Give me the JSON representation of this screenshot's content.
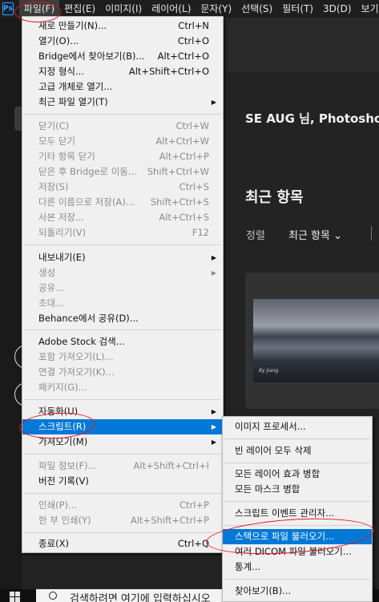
{
  "menubar": {
    "logo": "Ps",
    "items": [
      "파일(F)",
      "편집(E)",
      "이미지(I)",
      "레이어(L)",
      "문자(Y)",
      "선택(S)",
      "필터(T)",
      "3D(D)",
      "보기(V)"
    ]
  },
  "home": {
    "welcome": "SE AUG 님, Photoshop",
    "recent_title": "최근 항목",
    "sort_label": "정렬",
    "sort_value": "최근 항목 ⌄",
    "thumb_caption": "By Jiang"
  },
  "file_menu": {
    "items": [
      {
        "label": "새로 만들기(N)...",
        "shortcut": "Ctrl+N"
      },
      {
        "label": "열기(O)...",
        "shortcut": "Ctrl+O"
      },
      {
        "label": "Bridge에서 찾아보기(B)...",
        "shortcut": "Alt+Ctrl+O"
      },
      {
        "label": "지정 형식...",
        "shortcut": "Alt+Shift+Ctrl+O"
      },
      {
        "label": "고급 개체로 열기...",
        "shortcut": ""
      },
      {
        "label": "최근 파일 열기(T)",
        "shortcut": ""
      },
      {
        "label": "닫기(C)",
        "shortcut": "Ctrl+W"
      },
      {
        "label": "모두 닫기",
        "shortcut": "Alt+Ctrl+W"
      },
      {
        "label": "기타 항목 닫기",
        "shortcut": "Alt+Ctrl+P"
      },
      {
        "label": "닫은 후 Bridge로 이동...",
        "shortcut": "Shift+Ctrl+W"
      },
      {
        "label": "저장(S)",
        "shortcut": "Ctrl+S"
      },
      {
        "label": "다른 이름으로 저장(A)...",
        "shortcut": "Shift+Ctrl+S"
      },
      {
        "label": "사본 저장...",
        "shortcut": "Alt+Ctrl+S"
      },
      {
        "label": "되돌리기(V)",
        "shortcut": "F12"
      },
      {
        "label": "내보내기(E)",
        "shortcut": ""
      },
      {
        "label": "생성",
        "shortcut": ""
      },
      {
        "label": "공유...",
        "shortcut": ""
      },
      {
        "label": "초대...",
        "shortcut": ""
      },
      {
        "label": "Behance에서 공유(D)...",
        "shortcut": ""
      },
      {
        "label": "Adobe Stock 검색...",
        "shortcut": ""
      },
      {
        "label": "포함 가져오기(L)...",
        "shortcut": ""
      },
      {
        "label": "연결 가져오기(K)...",
        "shortcut": ""
      },
      {
        "label": "패키지(G)...",
        "shortcut": ""
      },
      {
        "label": "자동화(U)",
        "shortcut": ""
      },
      {
        "label": "스크립트(R)",
        "shortcut": ""
      },
      {
        "label": "가져오기(M)",
        "shortcut": ""
      },
      {
        "label": "파일 정보(F)...",
        "shortcut": "Alt+Shift+Ctrl+I"
      },
      {
        "label": "버전 기록(V)",
        "shortcut": ""
      },
      {
        "label": "인쇄(P)...",
        "shortcut": "Ctrl+P"
      },
      {
        "label": "한 부 인쇄(Y)",
        "shortcut": "Alt+Shift+Ctrl+P"
      },
      {
        "label": "종료(X)",
        "shortcut": "Ctrl+Q"
      }
    ]
  },
  "script_menu": {
    "items": [
      "이미지 프로세서...",
      "빈 레이어 모두 삭제",
      "모든 레이어 효과 병합",
      "모든 마스크 병합",
      "스크립트 이벤트 관리자...",
      "스택으로 파일 불러오기...",
      "여러 DICOM 파일 불러오기...",
      "통계...",
      "찾아보기(B)..."
    ]
  },
  "taskbar": {
    "search_text": "검색하려면 여기에 입력하십시오"
  },
  "colors": {
    "highlight": "#0078d7",
    "annotation": "#e8141e",
    "ps_accent": "#31a8ff"
  }
}
